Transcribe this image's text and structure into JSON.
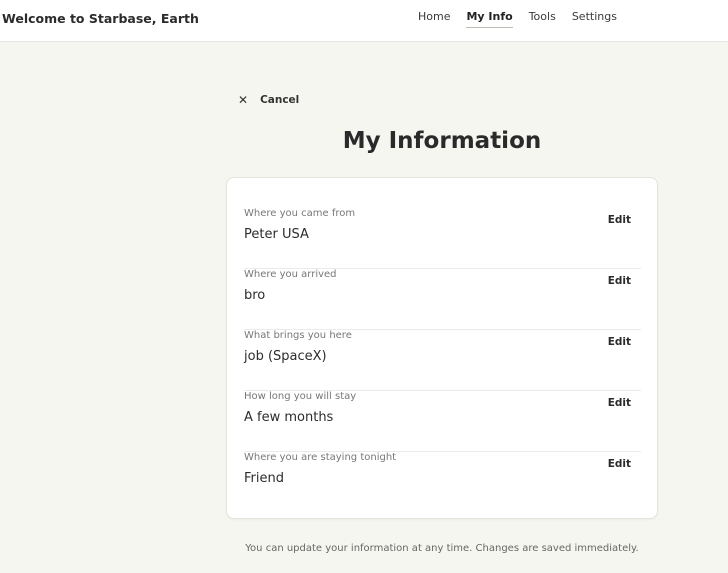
{
  "header": {
    "brand": "Welcome to Starbase, Earth",
    "nav": [
      {
        "label": "Home"
      },
      {
        "label": "My Info"
      },
      {
        "label": "Tools"
      },
      {
        "label": "Settings"
      }
    ],
    "active_nav": "My Info"
  },
  "cancel": {
    "icon": "close-icon",
    "label": "Cancel"
  },
  "page_title": "My Information",
  "fields": [
    {
      "label": "Where you came from",
      "value": "Peter USA",
      "edit_label": "Edit"
    },
    {
      "label": "Where you arrived",
      "value": "bro",
      "edit_label": "Edit"
    },
    {
      "label": "What brings you here",
      "value": "job (SpaceX)",
      "edit_label": "Edit"
    },
    {
      "label": "How long you will stay",
      "value": "A few months",
      "edit_label": "Edit"
    },
    {
      "label": "Where you are staying tonight",
      "value": "Friend",
      "edit_label": "Edit"
    }
  ],
  "footer_note": "You can update your information at any time. Changes are saved immediately."
}
